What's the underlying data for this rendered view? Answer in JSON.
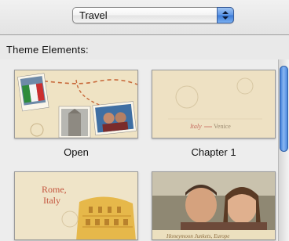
{
  "theme_selector": {
    "selected": "Travel"
  },
  "section": {
    "label": "Theme Elements:"
  },
  "tiles": [
    {
      "caption": "Open"
    },
    {
      "caption": "Chapter 1",
      "postcard_text_left": "Italy",
      "postcard_text_right": "Venice"
    },
    {
      "caption": "",
      "title": "Rome,",
      "subtitle": "Italy"
    },
    {
      "caption": "",
      "photo_caption": "Honeymoon Junkets, Europe"
    }
  ]
}
